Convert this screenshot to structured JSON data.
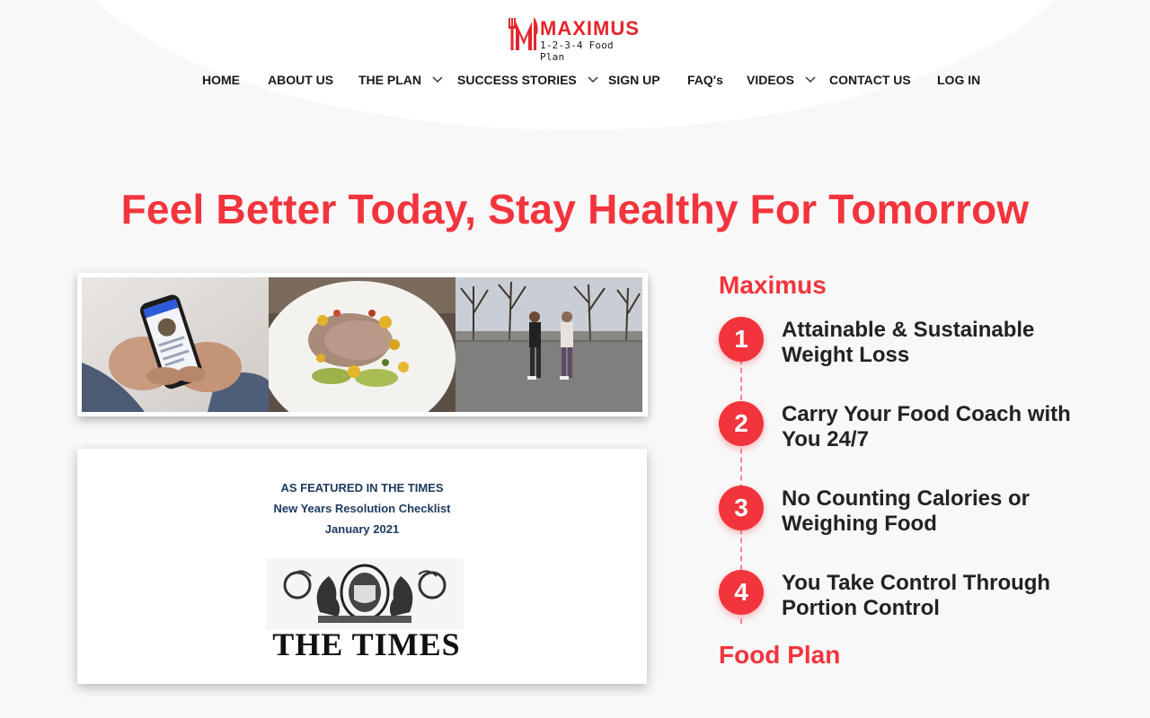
{
  "brand": {
    "name": "MAXIMUS",
    "tagline": "1-2-3-4 Food Plan",
    "color": "#e5252c"
  },
  "nav": {
    "items": [
      {
        "label": "HOME",
        "has_dropdown": false
      },
      {
        "label": "ABOUT US",
        "has_dropdown": false
      },
      {
        "label": "THE PLAN",
        "has_dropdown": true
      },
      {
        "label": "SUCCESS STORIES",
        "has_dropdown": true
      },
      {
        "label": "SIGN UP",
        "has_dropdown": false
      },
      {
        "label": "FAQ's",
        "has_dropdown": false
      },
      {
        "label": "VIDEOS",
        "has_dropdown": true
      },
      {
        "label": "CONTACT US",
        "has_dropdown": false
      },
      {
        "label": "LOG IN",
        "has_dropdown": false
      }
    ]
  },
  "hero": {
    "headline": "Feel Better Today, Stay Healthy For Tomorrow"
  },
  "photos": [
    "phone-app-photo",
    "tuna-salad-photo",
    "couple-walking-photo"
  ],
  "press": {
    "line1": "AS FEATURED IN THE TIMES",
    "line2": "New Years Resolution Checklist",
    "line3": "January 2021",
    "logo_text": "THE TIMES"
  },
  "features": {
    "title": "Maximus",
    "steps": [
      {
        "num": "1",
        "text": "Attainable & Sustainable Weight Loss"
      },
      {
        "num": "2",
        "text": "Carry Your Food Coach with You 24/7"
      },
      {
        "num": "3",
        "text": "No Counting Calories or Weighing Food"
      },
      {
        "num": "4",
        "text": "You Take Control Through Portion Control"
      }
    ],
    "next_title": "Food Plan"
  },
  "colors": {
    "accent": "#f2343d",
    "background": "#f8f8f8"
  }
}
